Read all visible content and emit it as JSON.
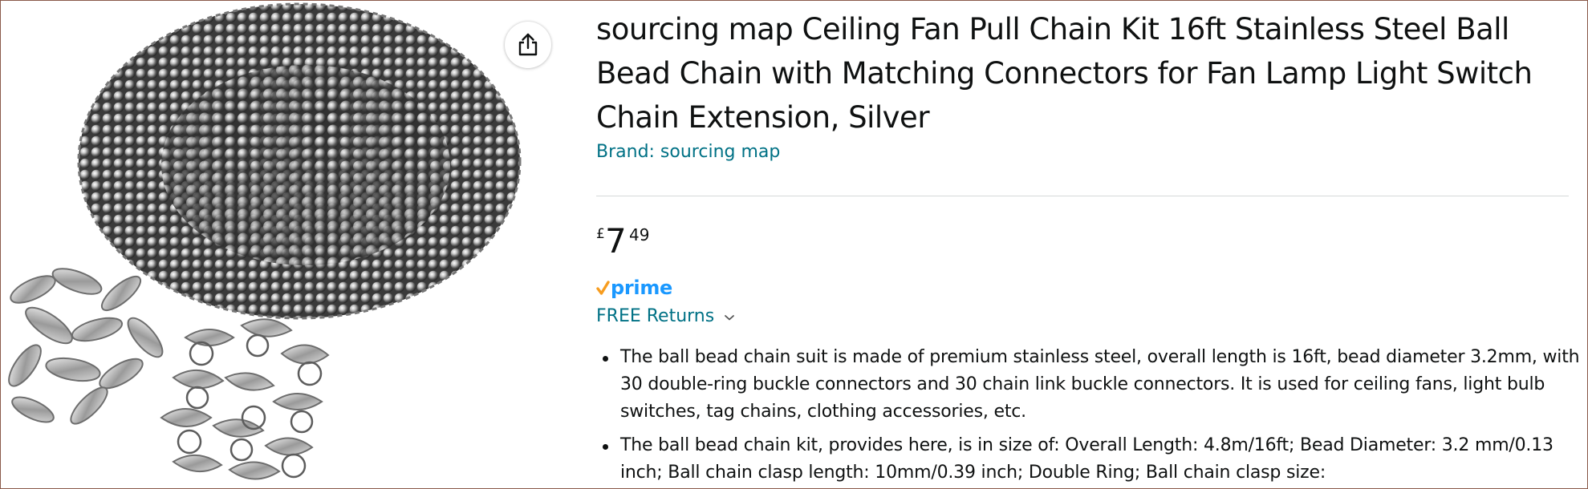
{
  "product": {
    "title": "sourcing map Ceiling Fan Pull Chain Kit 16ft Stainless Steel Ball Bead Chain with Matching Connectors for Fan Lamp Light Switch Chain Extension, Silver",
    "brand": "Brand: sourcing map",
    "image_icon": "ball-chain-product-photo"
  },
  "price": {
    "symbol": "£",
    "whole": "7",
    "fraction": "49"
  },
  "prime": {
    "label": "prime",
    "check_color": "#f79c1e",
    "color": "#1a98ff"
  },
  "returns": {
    "label": "FREE Returns",
    "icon": "chevron-down-icon"
  },
  "share": {
    "icon": "share-icon"
  },
  "bullets": [
    "The ball bead chain suit is made of premium stainless steel, overall length is 16ft, bead diameter 3.2mm, with 30 double-ring buckle connectors and 30 chain link buckle connectors. It is used for ceiling fans, light bulb switches, tag chains, clothing accessories, etc.",
    "The ball bead chain kit, provides here, is in size of: Overall Length: 4.8m/16ft; Bead Diameter: 3.2 mm/0.13 inch; Ball chain clasp length: 10mm/0.39 inch; Double Ring; Ball chain clasp size:"
  ],
  "colors": {
    "link": "#007185",
    "text": "#0f1111",
    "divider": "#d5d9d9"
  }
}
